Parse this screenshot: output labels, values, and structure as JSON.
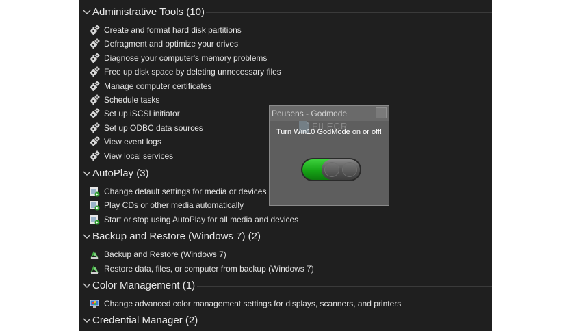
{
  "groups": [
    {
      "title": "Administrative Tools (10)",
      "icon": "gear-icon",
      "items": [
        {
          "label": "Create and format hard disk partitions"
        },
        {
          "label": "Defragment and optimize your drives"
        },
        {
          "label": "Diagnose your computer's memory problems"
        },
        {
          "label": "Free up disk space by deleting unnecessary files"
        },
        {
          "label": "Manage computer certificates"
        },
        {
          "label": "Schedule tasks"
        },
        {
          "label": "Set up iSCSI initiator"
        },
        {
          "label": "Set up ODBC data sources"
        },
        {
          "label": "View event logs"
        },
        {
          "label": "View local services"
        }
      ]
    },
    {
      "title": "AutoPlay (3)",
      "icon": "autoplay-icon",
      "items": [
        {
          "label": "Change default settings for media or devices"
        },
        {
          "label": "Play CDs or other media automatically"
        },
        {
          "label": "Start or stop using AutoPlay for all media and devices"
        }
      ]
    },
    {
      "title": "Backup and Restore (Windows 7) (2)",
      "icon": "backup-restore-icon",
      "items": [
        {
          "label": "Backup and Restore (Windows 7)"
        },
        {
          "label": "Restore data, files, or computer from backup (Windows 7)"
        }
      ]
    },
    {
      "title": "Color Management (1)",
      "icon": "color-management-icon",
      "items": [
        {
          "label": "Change advanced color management settings for displays, scanners, and printers"
        }
      ]
    },
    {
      "title": "Credential Manager (2)",
      "icon": "credential-manager-icon",
      "items": []
    }
  ],
  "dialog": {
    "title": "Peusens - Godmode",
    "message": "Turn Win10 GodMode on or off!",
    "watermark": "FILECR",
    "toggle_state": "on",
    "colors": {
      "toggle_on": "#16a316",
      "background": "#5e5e5e"
    }
  },
  "colors": {
    "panel_background": "#1f1f1f",
    "text": "#e2e2e2"
  }
}
